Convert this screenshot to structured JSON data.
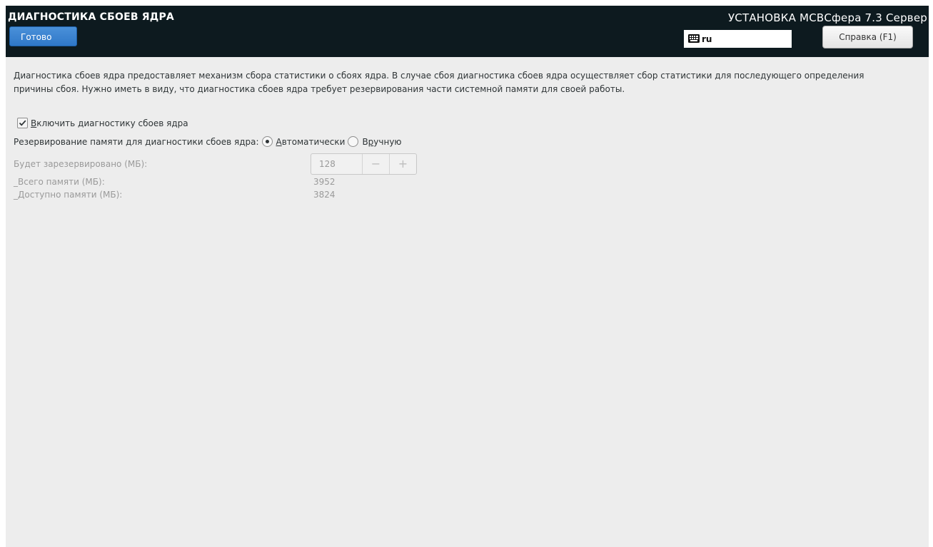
{
  "header": {
    "page_title": "ДИАГНОСТИКА СБОЕВ ЯДРА",
    "done_label": "Готово",
    "product_title": "УСТАНОВКА МСВСфера 7.3 Сервер",
    "keyboard_layout": "ru",
    "help_label": "Справка (F1)"
  },
  "description": "Диагностика сбоев ядра предоставляет механизм сбора статистики о сбоях ядра. В случае сбоя диагностика сбоев ядра осуществляет сбор статистики для последующего определения причины сбоя. Нужно иметь в виду, что диагностика сбоев ядра требует резервирования части системной памяти для своей работы.",
  "enable": {
    "mnemonic": "В",
    "label_rest": "ключить диагностику сбоев ядра",
    "checked": true
  },
  "reservation": {
    "label": "Резервирование памяти для диагностики сбоев ядра:",
    "auto_mnemonic": "А",
    "auto_rest": "втоматически",
    "manual_start": "В",
    "manual_mnemonic": "р",
    "manual_rest": "учную",
    "selected": "auto"
  },
  "memory": {
    "reserved_label": "Будет зарезервировано (МБ):",
    "reserved_value": "128",
    "minus": "−",
    "plus": "+",
    "total_label": "_Всего памяти (МБ):",
    "total_value": "3952",
    "available_label": "_Доступно памяти (МБ):",
    "available_value": "3824"
  },
  "colors": {
    "header_bg": "#0d1a1f",
    "accent": "#3b86d5",
    "content_bg": "#ededed"
  }
}
